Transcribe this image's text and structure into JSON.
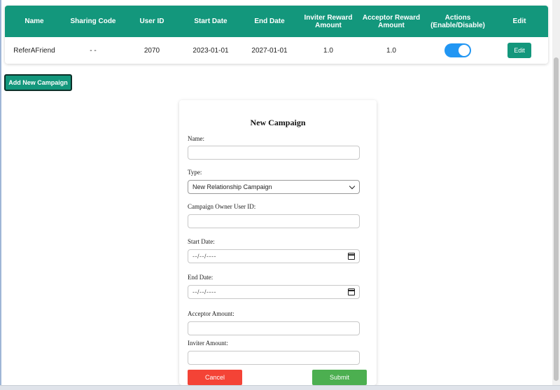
{
  "table": {
    "headers": [
      "Name",
      "Sharing Code",
      "User ID",
      "Start Date",
      "End Date",
      "Inviter Reward Amount",
      "Acceptor Reward Amount",
      "Actions (Enable/Disable)",
      "Edit"
    ],
    "rows": [
      {
        "name": "ReferAFriend",
        "sharing_code": "- -",
        "user_id": "2070",
        "start_date": "2023-01-01",
        "end_date": "2027-01-01",
        "inviter_reward": "1.0",
        "acceptor_reward": "1.0",
        "enabled": true,
        "edit_label": "Edit"
      }
    ]
  },
  "add_button_label": "Add New Campaign",
  "form": {
    "title": "New Campaign",
    "name_label": "Name:",
    "name_value": "",
    "type_label": "Type:",
    "type_value": "New Relationship Campaign",
    "owner_label": "Campaign Owner User ID:",
    "owner_value": "",
    "start_label": "Start Date:",
    "start_placeholder": "--/--/----",
    "end_label": "End Date:",
    "end_placeholder": "--/--/----",
    "acceptor_label": "Acceptor Amount:",
    "acceptor_value": "",
    "inviter_label": "Inviter Amount:",
    "inviter_value": "",
    "cancel_label": "Cancel",
    "submit_label": "Submit"
  },
  "colors": {
    "header_bg": "#13977c",
    "toggle_on": "#2196f3",
    "cancel": "#f44336",
    "submit": "#4caf50"
  },
  "icons": {
    "date_picker": "calendar-icon",
    "select": "chevron-down-icon"
  }
}
